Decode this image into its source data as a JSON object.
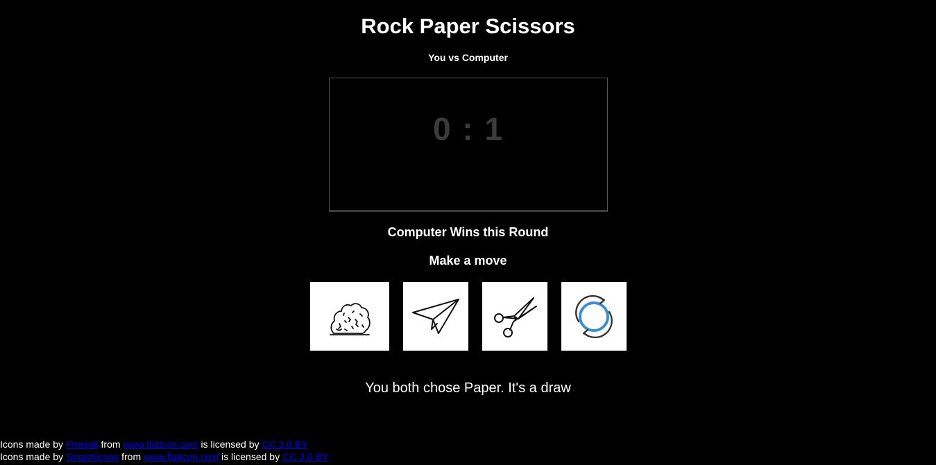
{
  "header": {
    "title": "Rock Paper Scissors",
    "subtitle": "You vs Computer"
  },
  "scoreboard": {
    "user_score": "0",
    "separator": ":",
    "computer_score": "1"
  },
  "result_text": "Computer Wins this Round",
  "prompt": "Make a move",
  "choices": [
    {
      "id": "rock",
      "icon": "rock-icon"
    },
    {
      "id": "paper",
      "icon": "paper-plane-icon"
    },
    {
      "id": "scissors",
      "icon": "scissors-icon"
    },
    {
      "id": "reset",
      "icon": "refresh-icon"
    }
  ],
  "message": "You both chose Paper. It's a draw",
  "credits": [
    {
      "prefix": "Icons made by",
      "author": "Freepik",
      "middle": "from",
      "site": "www.flaticon.com",
      "suffix": "is licensed by",
      "license": "CC 3.0 BY"
    },
    {
      "prefix": "Icons made by",
      "author": "Smashicons",
      "middle": "from",
      "site": "www.flaticon.com",
      "suffix": "is licensed by",
      "license": "CC 3.0 BY"
    }
  ],
  "colors": {
    "background": "#000000",
    "text": "#ffffff",
    "score": "#3b3b3b",
    "link": "#0000ee",
    "refresh_ring": "#3b8fd1"
  }
}
